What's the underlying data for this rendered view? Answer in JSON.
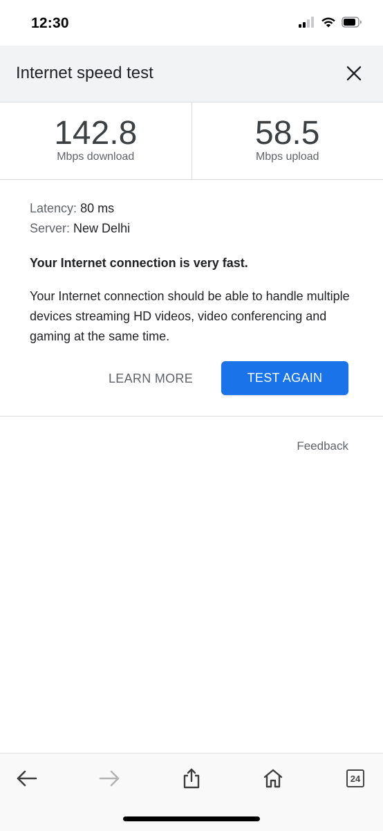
{
  "status_bar": {
    "time": "12:30",
    "icons": [
      "cellular-signal-icon",
      "wifi-icon",
      "battery-icon"
    ]
  },
  "header": {
    "title": "Internet speed test",
    "close_icon": "close-icon"
  },
  "metrics": {
    "download_value": "142.8",
    "download_label": "Mbps download",
    "upload_value": "58.5",
    "upload_label": "Mbps upload"
  },
  "details": {
    "latency_label": "Latency:",
    "latency_value": "80 ms",
    "server_label": "Server:",
    "server_value": "New Delhi",
    "verdict": "Your Internet connection is very fast.",
    "description": "Your Internet connection should be able to handle multiple devices streaming HD videos, video conferencing and gaming at the same time."
  },
  "actions": {
    "learn_more": "LEARN MORE",
    "test_again": "TEST AGAIN"
  },
  "feedback": "Feedback",
  "toolbar": {
    "tabs_count": "24",
    "icons": [
      "back-arrow-icon",
      "forward-arrow-icon",
      "share-icon",
      "home-icon",
      "tabs-icon"
    ]
  },
  "colors": {
    "primary_button": "#1a73e8",
    "header_bg": "#f1f3f4",
    "divider": "#dadce0",
    "secondary_text": "#5f6368"
  }
}
